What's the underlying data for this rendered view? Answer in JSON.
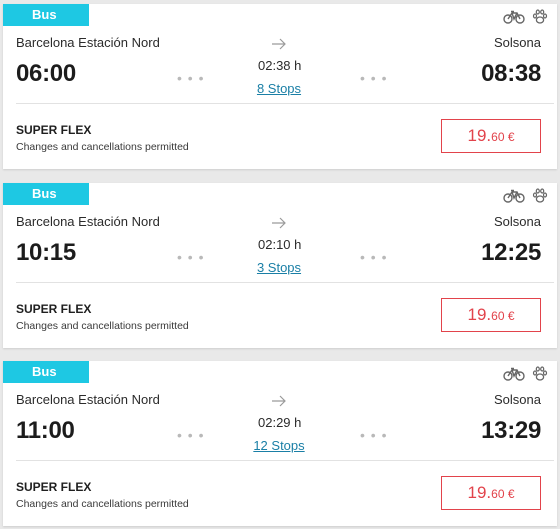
{
  "trips": [
    {
      "mode": "Bus",
      "origin": "Barcelona Estación Nord",
      "destination": "Solsona",
      "departure": "06:00",
      "arrival": "08:38",
      "duration": "02:38 h",
      "stops": "8 Stops",
      "fare_name": "SUPER FLEX",
      "fare_desc": "Changes and cancellations permitted",
      "price_int": "19.",
      "price_dec": "60 €"
    },
    {
      "mode": "Bus",
      "origin": "Barcelona Estación Nord",
      "destination": "Solsona",
      "departure": "10:15",
      "arrival": "12:25",
      "duration": "02:10 h",
      "stops": "3 Stops",
      "fare_name": "SUPER FLEX",
      "fare_desc": "Changes and cancellations permitted",
      "price_int": "19.",
      "price_dec": "60 €"
    },
    {
      "mode": "Bus",
      "origin": "Barcelona Estación Nord",
      "destination": "Solsona",
      "departure": "11:00",
      "arrival": "13:29",
      "duration": "02:29 h",
      "stops": "12 Stops",
      "fare_name": "SUPER FLEX",
      "fare_desc": "Changes and cancellations permitted",
      "price_int": "19.",
      "price_dec": "60 €"
    }
  ],
  "amenity_icons": [
    "bike-icon",
    "pet-paw-icon"
  ],
  "colors": {
    "badge": "#1ec8e3",
    "price": "#e2434b",
    "link": "#1a7fa6"
  }
}
